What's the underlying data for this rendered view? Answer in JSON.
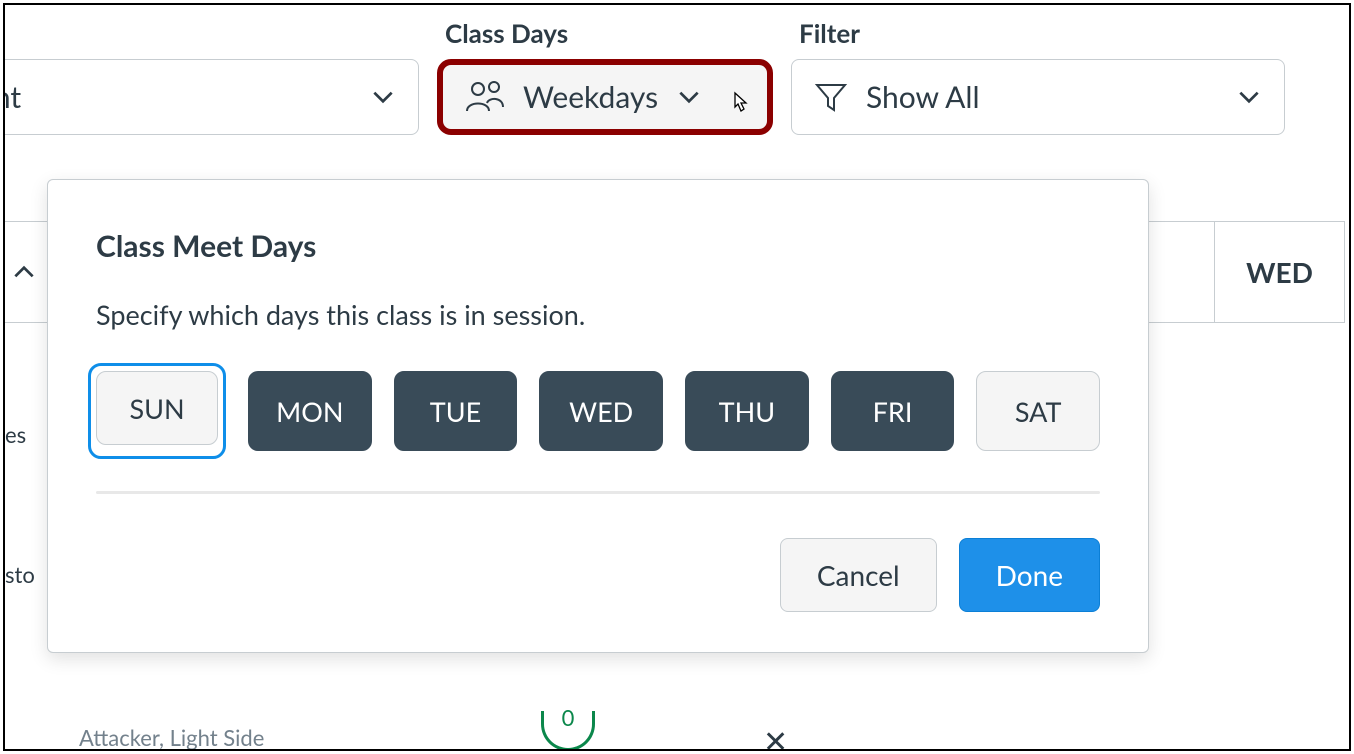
{
  "toolbar": {
    "student_dropdown": {
      "label": "",
      "visible_text": "ident"
    },
    "class_days": {
      "header": "Class Days",
      "value": "Weekdays"
    },
    "filter": {
      "header": "Filter",
      "value": "Show All"
    }
  },
  "background": {
    "column_header_day": "WED",
    "row1_fragment": "es",
    "row2_fragment": "sto",
    "bottom_name": "Attacker, Light Side",
    "bottom_count": "0",
    "bottom_x": "✕"
  },
  "popover": {
    "title": "Class Meet Days",
    "description": "Specify which days this class is in session.",
    "days": [
      {
        "label": "SUN",
        "selected": false,
        "focused": true
      },
      {
        "label": "MON",
        "selected": true,
        "focused": false
      },
      {
        "label": "TUE",
        "selected": true,
        "focused": false
      },
      {
        "label": "WED",
        "selected": true,
        "focused": false
      },
      {
        "label": "THU",
        "selected": true,
        "focused": false
      },
      {
        "label": "FRI",
        "selected": true,
        "focused": false
      },
      {
        "label": "SAT",
        "selected": false,
        "focused": false
      }
    ],
    "cancel": "Cancel",
    "done": "Done"
  }
}
